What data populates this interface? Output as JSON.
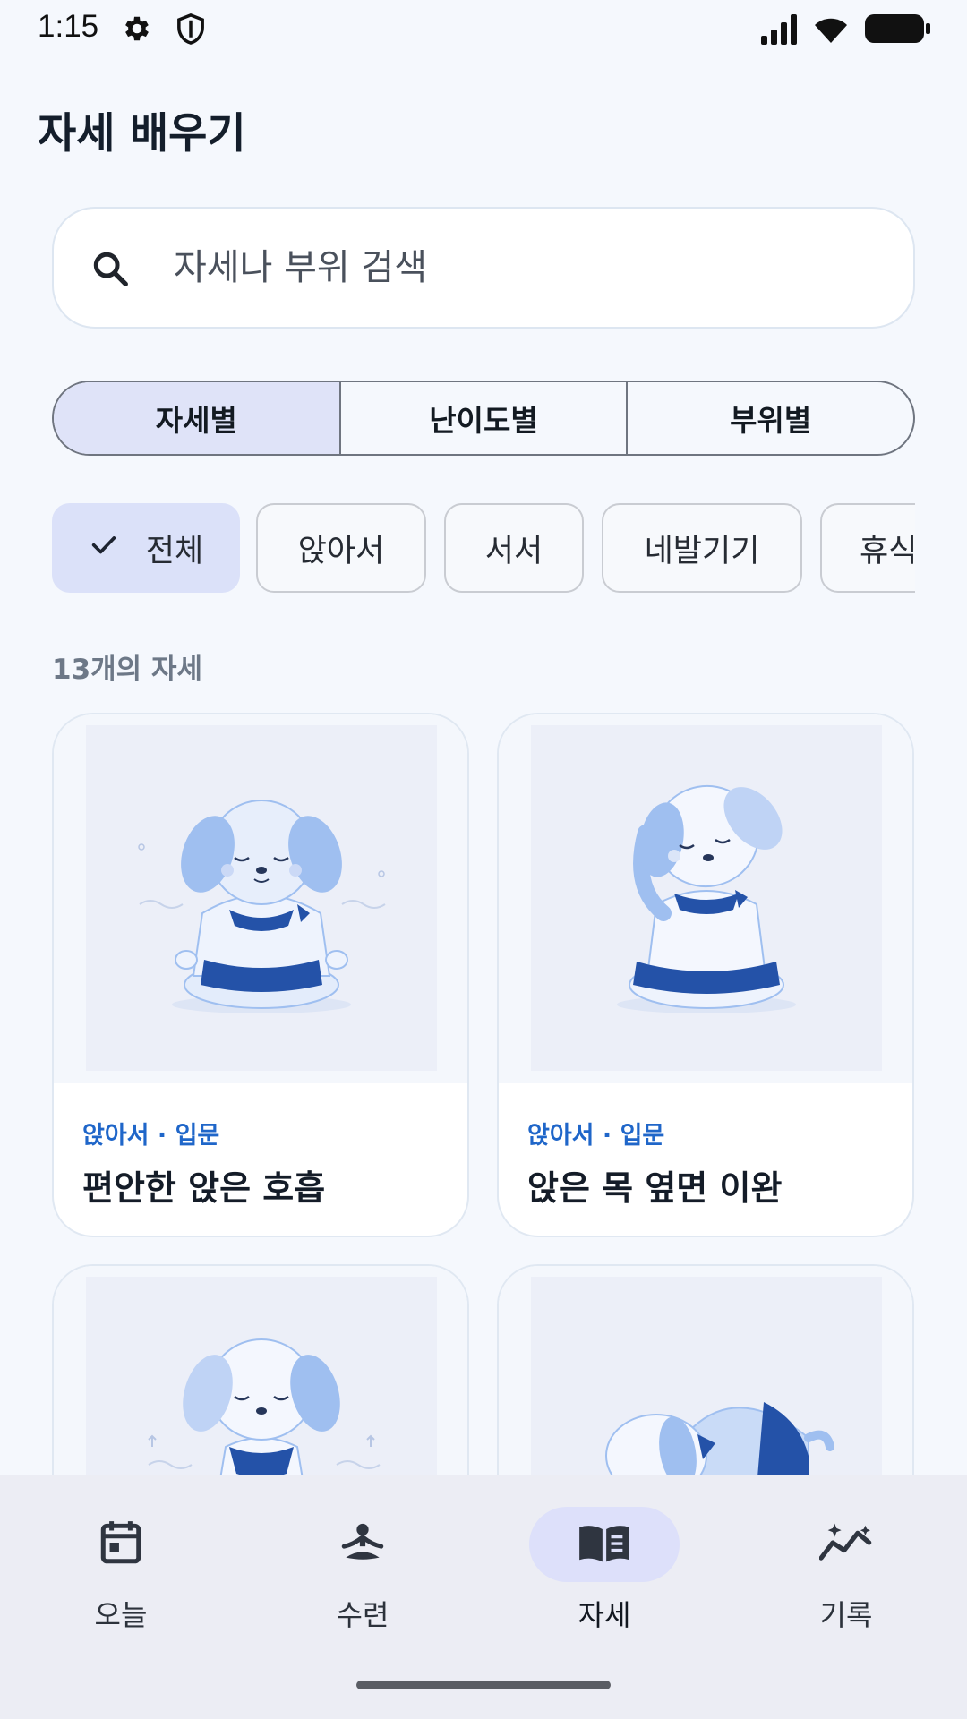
{
  "status_bar": {
    "time": "1:15",
    "icons": [
      "gear-icon",
      "shield-icon",
      "signal-icon",
      "wifi-icon",
      "battery-icon"
    ]
  },
  "page": {
    "title": "자세 배우기"
  },
  "search": {
    "placeholder": "자세나 부위 검색",
    "icon": "search-icon"
  },
  "segments": [
    {
      "label": "자세별",
      "active": true
    },
    {
      "label": "난이도별",
      "active": false
    },
    {
      "label": "부위별",
      "active": false
    }
  ],
  "chips": [
    {
      "label": "전체",
      "selected": true
    },
    {
      "label": "앉아서",
      "selected": false
    },
    {
      "label": "서서",
      "selected": false
    },
    {
      "label": "네발기기",
      "selected": false
    },
    {
      "label": "휴식",
      "selected": false
    }
  ],
  "result_count": "13개의 자세",
  "cards": [
    {
      "meta": "앉아서 · 입문",
      "title": "편안한 앉은 호흡",
      "illustration": "puppy-meditation-illustration"
    },
    {
      "meta": "앉아서 · 입문",
      "title": "앉은 목 옆면 이완",
      "illustration": "puppy-neck-stretch-illustration"
    },
    {
      "meta": "",
      "title": "",
      "illustration": "puppy-standing-breath-illustration"
    },
    {
      "meta": "",
      "title": "",
      "illustration": "puppy-child-pose-illustration"
    }
  ],
  "bottom_nav": [
    {
      "label": "오늘",
      "icon": "calendar-icon",
      "active": false
    },
    {
      "label": "수련",
      "icon": "meditation-icon",
      "active": false
    },
    {
      "label": "자세",
      "icon": "book-icon",
      "active": true
    },
    {
      "label": "기록",
      "icon": "chart-sparkle-icon",
      "active": false
    }
  ],
  "colors": {
    "background": "#f5f8fd",
    "accent_text": "#1f66c9",
    "selected_fill": "#dfe3f8",
    "illustration_blue": "#9fbff0",
    "illustration_navy": "#2452a8"
  }
}
